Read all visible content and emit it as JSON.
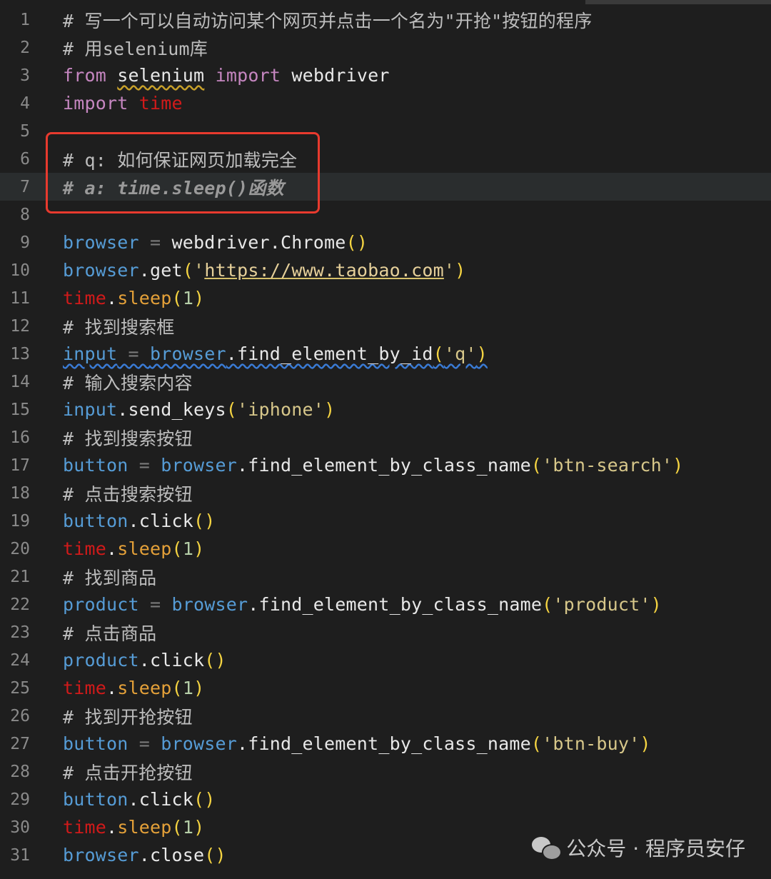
{
  "editor": {
    "lines": [
      {
        "n": "1",
        "tokens": [
          {
            "t": "# 写一个可以自动访问某个网页并点击一个名为\"开抢\"按钮的程序",
            "c": "cm"
          }
        ]
      },
      {
        "n": "2",
        "tokens": [
          {
            "t": "# 用selenium库",
            "c": "cm"
          }
        ]
      },
      {
        "n": "3",
        "tokens": [
          {
            "t": "from",
            "c": "kw"
          },
          {
            "t": " "
          },
          {
            "t": "selenium",
            "c": "mod squig-y"
          },
          {
            "t": " "
          },
          {
            "t": "import",
            "c": "kw"
          },
          {
            "t": " webdriver",
            "c": "mod"
          }
        ]
      },
      {
        "n": "4",
        "tokens": [
          {
            "t": "import",
            "c": "kw"
          },
          {
            "t": " "
          },
          {
            "t": "time",
            "c": "red"
          }
        ]
      },
      {
        "n": "5",
        "tokens": []
      },
      {
        "n": "6",
        "tokens": [
          {
            "t": "# q: 如何保证网页加载完全",
            "c": "cm"
          }
        ]
      },
      {
        "n": "7",
        "current": true,
        "tokens": [
          {
            "t": "# a: time.sleep()函数",
            "c": "cm-it"
          }
        ]
      },
      {
        "n": "8",
        "tokens": []
      },
      {
        "n": "9",
        "tokens": [
          {
            "t": "browser",
            "c": "var"
          },
          {
            "t": " = ",
            "c": "op"
          },
          {
            "t": "webdriver.Chrome",
            "c": "fn"
          },
          {
            "t": "()",
            "c": "par"
          }
        ]
      },
      {
        "n": "10",
        "tokens": [
          {
            "t": "browser",
            "c": "var"
          },
          {
            "t": ".get",
            "c": "fn"
          },
          {
            "t": "(",
            "c": "par"
          },
          {
            "t": "'",
            "c": "strg"
          },
          {
            "t": "https://www.taobao.com",
            "c": "url"
          },
          {
            "t": "'",
            "c": "strg"
          },
          {
            "t": ")",
            "c": "par"
          }
        ]
      },
      {
        "n": "11",
        "tokens": [
          {
            "t": "time",
            "c": "red"
          },
          {
            "t": ".",
            "c": "fn"
          },
          {
            "t": "sleep",
            "c": "mth"
          },
          {
            "t": "(",
            "c": "par"
          },
          {
            "t": "1",
            "c": "num"
          },
          {
            "t": ")",
            "c": "par"
          }
        ]
      },
      {
        "n": "12",
        "tokens": [
          {
            "t": "# 找到搜索框",
            "c": "cm"
          }
        ]
      },
      {
        "n": "13",
        "tokens": [
          {
            "t": "input",
            "c": "var squig-b"
          },
          {
            "t": " = ",
            "c": "op squig-b"
          },
          {
            "t": "browser",
            "c": "var squig-b"
          },
          {
            "t": ".find_element_by_id",
            "c": "fn squig-b"
          },
          {
            "t": "(",
            "c": "par squig-b"
          },
          {
            "t": "'q'",
            "c": "strg squig-b"
          },
          {
            "t": ")",
            "c": "par squig-b"
          }
        ]
      },
      {
        "n": "14",
        "tokens": [
          {
            "t": "# 输入搜索内容",
            "c": "cm"
          }
        ]
      },
      {
        "n": "15",
        "tokens": [
          {
            "t": "input",
            "c": "var"
          },
          {
            "t": ".send_keys",
            "c": "fn"
          },
          {
            "t": "(",
            "c": "par"
          },
          {
            "t": "'iphone'",
            "c": "strg"
          },
          {
            "t": ")",
            "c": "par"
          }
        ]
      },
      {
        "n": "16",
        "tokens": [
          {
            "t": "# 找到搜索按钮",
            "c": "cm"
          }
        ]
      },
      {
        "n": "17",
        "tokens": [
          {
            "t": "button",
            "c": "var"
          },
          {
            "t": " = ",
            "c": "op"
          },
          {
            "t": "browser",
            "c": "var"
          },
          {
            "t": ".find_element_by_class_name",
            "c": "fn"
          },
          {
            "t": "(",
            "c": "par"
          },
          {
            "t": "'btn-search'",
            "c": "strg"
          },
          {
            "t": ")",
            "c": "par"
          }
        ]
      },
      {
        "n": "18",
        "tokens": [
          {
            "t": "# 点击搜索按钮",
            "c": "cm"
          }
        ]
      },
      {
        "n": "19",
        "tokens": [
          {
            "t": "button",
            "c": "var"
          },
          {
            "t": ".click",
            "c": "fn"
          },
          {
            "t": "()",
            "c": "par"
          }
        ]
      },
      {
        "n": "20",
        "tokens": [
          {
            "t": "time",
            "c": "red"
          },
          {
            "t": ".",
            "c": "fn"
          },
          {
            "t": "sleep",
            "c": "mth"
          },
          {
            "t": "(",
            "c": "par"
          },
          {
            "t": "1",
            "c": "num"
          },
          {
            "t": ")",
            "c": "par"
          }
        ]
      },
      {
        "n": "21",
        "tokens": [
          {
            "t": "# 找到商品",
            "c": "cm"
          }
        ]
      },
      {
        "n": "22",
        "tokens": [
          {
            "t": "product",
            "c": "var"
          },
          {
            "t": " = ",
            "c": "op"
          },
          {
            "t": "browser",
            "c": "var"
          },
          {
            "t": ".find_element_by_class_name",
            "c": "fn"
          },
          {
            "t": "(",
            "c": "par"
          },
          {
            "t": "'product'",
            "c": "strg"
          },
          {
            "t": ")",
            "c": "par"
          }
        ]
      },
      {
        "n": "23",
        "tokens": [
          {
            "t": "# 点击商品",
            "c": "cm"
          }
        ]
      },
      {
        "n": "24",
        "tokens": [
          {
            "t": "product",
            "c": "var"
          },
          {
            "t": ".click",
            "c": "fn"
          },
          {
            "t": "()",
            "c": "par"
          }
        ]
      },
      {
        "n": "25",
        "tokens": [
          {
            "t": "time",
            "c": "red"
          },
          {
            "t": ".",
            "c": "fn"
          },
          {
            "t": "sleep",
            "c": "mth"
          },
          {
            "t": "(",
            "c": "par"
          },
          {
            "t": "1",
            "c": "num"
          },
          {
            "t": ")",
            "c": "par"
          }
        ]
      },
      {
        "n": "26",
        "tokens": [
          {
            "t": "# 找到开抢按钮",
            "c": "cm"
          }
        ]
      },
      {
        "n": "27",
        "tokens": [
          {
            "t": "button",
            "c": "var"
          },
          {
            "t": " = ",
            "c": "op"
          },
          {
            "t": "browser",
            "c": "var"
          },
          {
            "t": ".find_element_by_class_name",
            "c": "fn"
          },
          {
            "t": "(",
            "c": "par"
          },
          {
            "t": "'btn-buy'",
            "c": "strg"
          },
          {
            "t": ")",
            "c": "par"
          }
        ]
      },
      {
        "n": "28",
        "tokens": [
          {
            "t": "# 点击开抢按钮",
            "c": "cm"
          }
        ]
      },
      {
        "n": "29",
        "tokens": [
          {
            "t": "button",
            "c": "var"
          },
          {
            "t": ".click",
            "c": "fn"
          },
          {
            "t": "()",
            "c": "par"
          }
        ]
      },
      {
        "n": "30",
        "tokens": [
          {
            "t": "time",
            "c": "red"
          },
          {
            "t": ".",
            "c": "fn"
          },
          {
            "t": "sleep",
            "c": "mth"
          },
          {
            "t": "(",
            "c": "par"
          },
          {
            "t": "1",
            "c": "num"
          },
          {
            "t": ")",
            "c": "par"
          }
        ]
      },
      {
        "n": "31",
        "tokens": [
          {
            "t": "browser",
            "c": "var"
          },
          {
            "t": ".close",
            "c": "fn"
          },
          {
            "t": "()",
            "c": "par"
          }
        ]
      }
    ]
  },
  "watermark": {
    "icon": "wechat-icon",
    "text": "公众号 · 程序员安仔"
  },
  "colors": {
    "background": "#1e1e1e",
    "highlight_box": "#e83a2e"
  }
}
